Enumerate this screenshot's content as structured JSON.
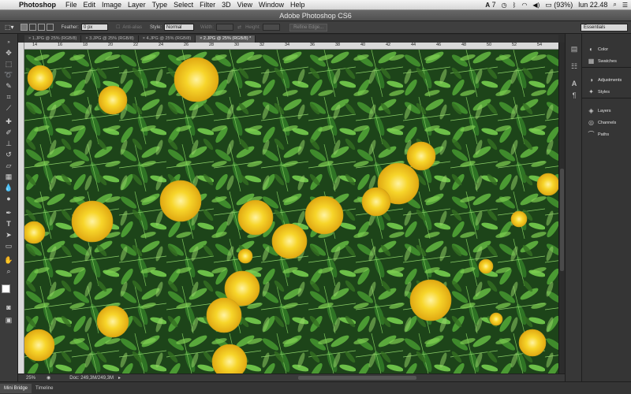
{
  "menubar": {
    "app_name": "Photoshop",
    "items": [
      "File",
      "Edit",
      "Image",
      "Layer",
      "Type",
      "Select",
      "Filter",
      "3D",
      "View",
      "Window",
      "Help"
    ],
    "status_adobe": "7",
    "battery": "(93%)",
    "clock": "lun 22.48"
  },
  "window": {
    "title": "Adobe Photoshop CS6"
  },
  "options": {
    "feather_label": "Feather:",
    "feather_value": "0 px",
    "antialias_label": "Anti-alias",
    "style_label": "Style:",
    "style_value": "Normal",
    "width_label": "Width:",
    "height_label": "Height:",
    "refine_edge": "Refine Edge...",
    "workspace": "Essentials"
  },
  "tabs": [
    {
      "label": "1.JPG @ 25% (RGB/8)",
      "active": false
    },
    {
      "label": "3.JPG @ 25% (RGB/8)",
      "active": false
    },
    {
      "label": "4.JPG @ 25% (RGB/8)",
      "active": false
    },
    {
      "label": "2.JPG @ 25% (RGB/8) *",
      "active": true
    }
  ],
  "ruler_h_ticks": [
    "14",
    "16",
    "18",
    "20",
    "22",
    "24",
    "26",
    "28",
    "30",
    "32",
    "34",
    "36",
    "38",
    "40",
    "42",
    "44",
    "46",
    "48",
    "50",
    "52",
    "54"
  ],
  "status": {
    "zoom": "25%",
    "doc": "Doc: 249,3M/249,3M"
  },
  "bottom_tabs": [
    "Mini Bridge",
    "Timeline"
  ],
  "panels": {
    "group1": [
      "Color",
      "Swatches"
    ],
    "group2": [
      "Adjustments",
      "Styles"
    ],
    "group3": [
      "Layers",
      "Channels",
      "Paths"
    ]
  },
  "colors": {
    "foreground": "#ffffff",
    "background": "#000000",
    "flower": "#f2c81e",
    "foliage": "#2f6b22"
  }
}
